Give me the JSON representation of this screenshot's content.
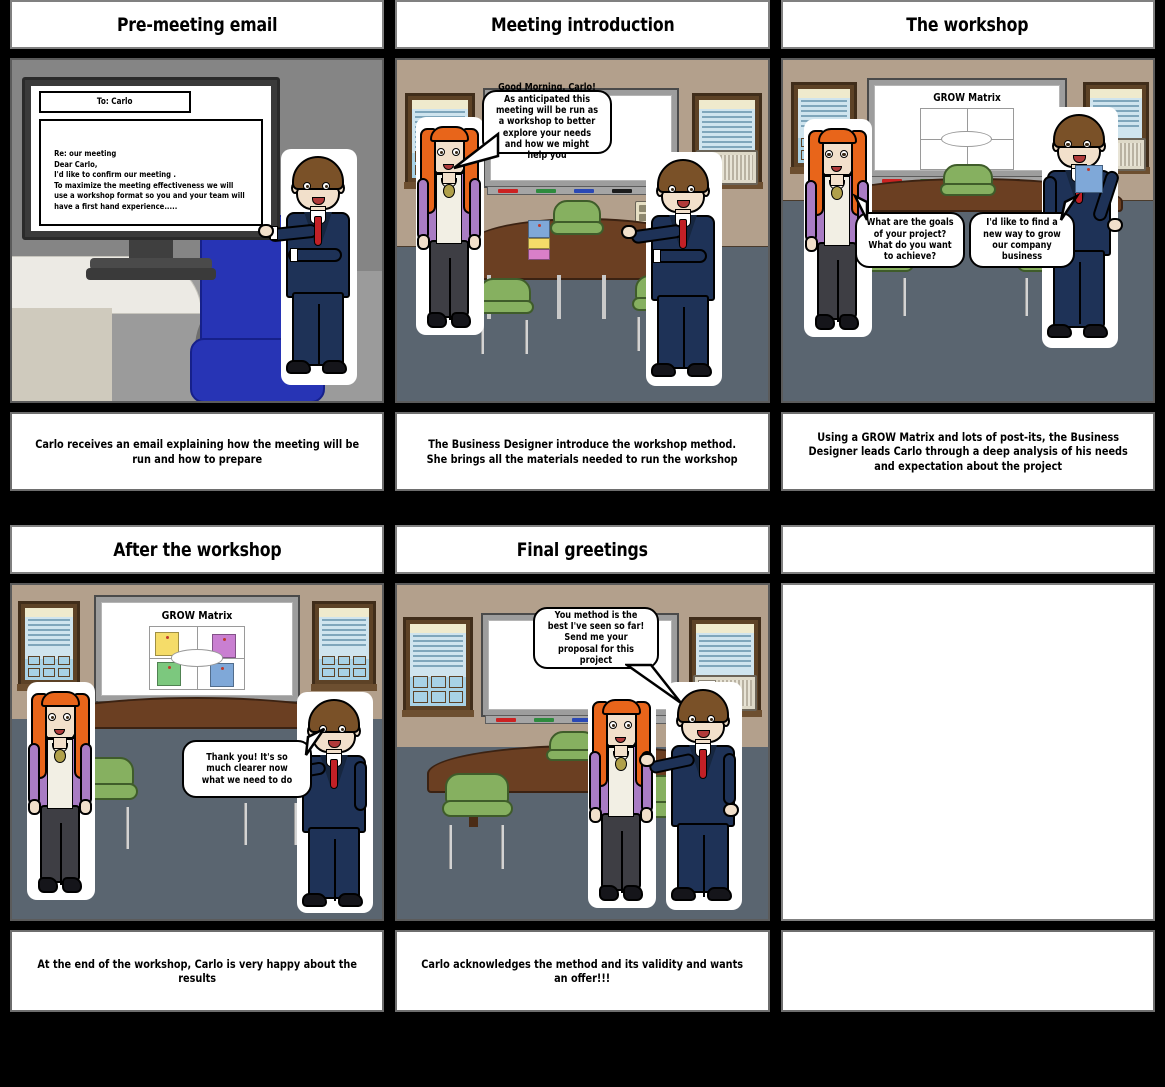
{
  "storyboard": {
    "cells": [
      {
        "id": "pre-meeting-email",
        "title": "Pre-meeting email",
        "caption": "Carlo receives an email explaining how the meeting will be run and how to prepare",
        "scene": "office-desk",
        "email": {
          "to_label": "To: Carlo",
          "body": "Re: our meeting\nDear Carlo,\nI'd like to confirm our meeting .\nTo maximize the meeting effectiveness we will use a workshop format so you and your team will have a first hand experience....."
        }
      },
      {
        "id": "meeting-introduction",
        "title": "Meeting introduction",
        "caption": "The Business Designer introduce the workshop method. She brings all the materials needed to run the workshop",
        "scene": "meeting-room",
        "bubbles": [
          {
            "speaker": "business-designer",
            "text": "Good Morning, Carlo!\nAs anticipated this meeting will be run as a workshop to better explore your needs and how we might help you"
          }
        ]
      },
      {
        "id": "the-workshop",
        "title": "The workshop",
        "caption": "Using a GROW Matrix and lots of post-its, the Business Designer leads Carlo through a deep analysis of his needs and expectation about the project",
        "scene": "meeting-room",
        "whiteboard": {
          "title": "GROW Matrix",
          "postits": []
        },
        "bubbles": [
          {
            "speaker": "business-designer",
            "text": "What are the goals of your project? What do you want to achieve?"
          },
          {
            "speaker": "carlo",
            "text": "I'd like to find a new way to grow our company business"
          }
        ]
      },
      {
        "id": "after-the-workshop",
        "title": "After the workshop",
        "caption": "At the end of the workshop, Carlo is very happy about the results",
        "scene": "meeting-room",
        "whiteboard": {
          "title": "GROW Matrix",
          "postits": [
            {
              "quadrant": "top-left",
              "color": "#f5dc69"
            },
            {
              "quadrant": "top-right",
              "color": "#c97fd1"
            },
            {
              "quadrant": "bottom-left",
              "color": "#7cc87e"
            },
            {
              "quadrant": "bottom-right",
              "color": "#7fa8d8"
            }
          ]
        },
        "bubbles": [
          {
            "speaker": "carlo",
            "text": "Thank you! It's so much clearer now what we need to do"
          }
        ]
      },
      {
        "id": "final-greetings",
        "title": "Final greetings",
        "caption": "Carlo acknowledges the method and its validity and wants an offer!!!",
        "scene": "meeting-room",
        "bubbles": [
          {
            "speaker": "carlo",
            "text": "You method is the best I've seen so far! Send me your proposal for this project"
          }
        ]
      },
      {
        "id": "empty-cell",
        "title": "",
        "caption": "",
        "scene": "empty"
      }
    ]
  },
  "palette": {
    "background": "#000000",
    "panel_border": "#5b5b5b",
    "title_background": "#ffffff",
    "wall": "#b3a08c",
    "floor": "#5a6570",
    "table_wood": "#6b3f22",
    "chair_green": "#86b060",
    "suit_navy": "#1e3257",
    "tie_red": "#c22026",
    "cardigan_purple": "#a97cc4",
    "hair_orange": "#e8651a",
    "office_chair_blue": "#2734b5",
    "window_frame": "#5d4226"
  }
}
